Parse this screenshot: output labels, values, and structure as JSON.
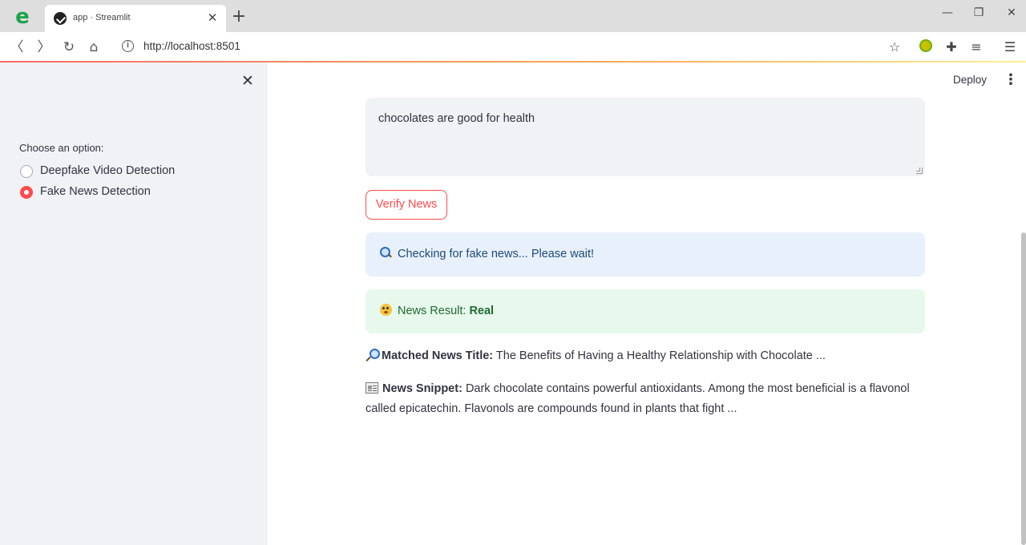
{
  "browser": {
    "tab_title": "app · Streamlit",
    "url": "http://localhost:8501"
  },
  "sidebar": {
    "radio_label": "Choose an option:",
    "options": [
      {
        "label": "Deepfake Video Detection",
        "selected": false
      },
      {
        "label": "Fake News Detection",
        "selected": true
      }
    ]
  },
  "header": {
    "deploy_label": "Deploy"
  },
  "main": {
    "news_input_value": "chocolates are good for health",
    "verify_button_label": "Verify News",
    "info_message": "Checking for fake news... Please wait!",
    "result_prefix": "News Result:",
    "result_value": "Real",
    "matched_title_label": "Matched News Title:",
    "matched_title_value": "The Benefits of Having a Healthy Relationship with Chocolate ...",
    "snippet_label": "News Snippet:",
    "snippet_value": "Dark chocolate contains powerful antioxidants. Among the most beneficial is a flavonol called epicatechin. Flavonols are compounds found in plants that fight ..."
  },
  "colors": {
    "accent": "#ff4b4b",
    "sidebar_bg": "#f0f2f6",
    "info_bg": "#e8f1fb",
    "success_bg": "#e7f8ec"
  }
}
